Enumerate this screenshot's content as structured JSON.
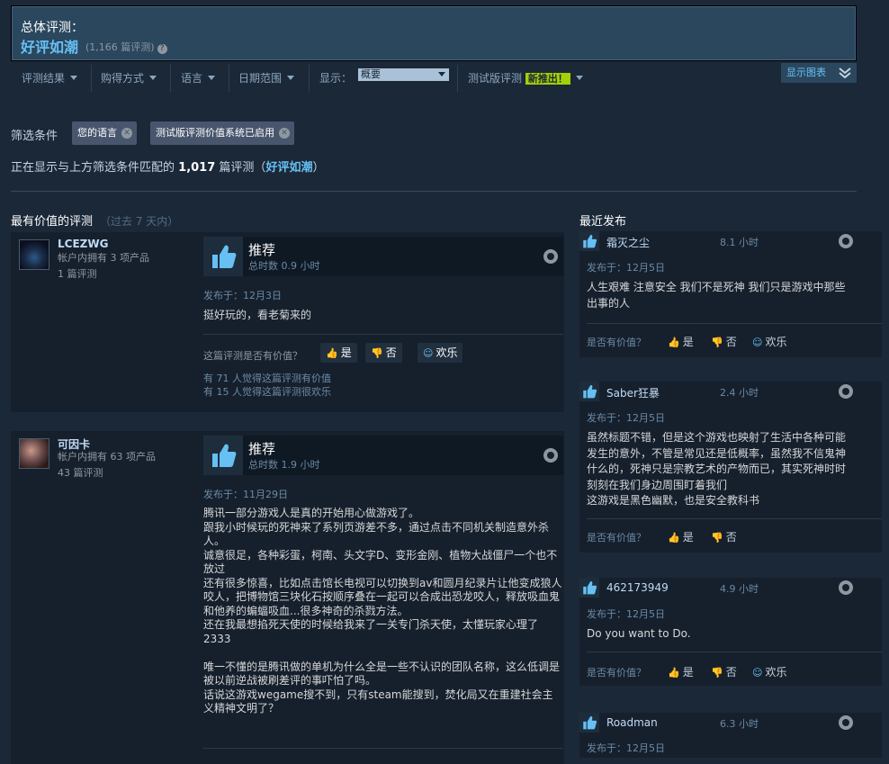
{
  "summary": {
    "label": "总体评测：",
    "rating": "好评如潮",
    "count": "(1,166 篇评测)",
    "help": "?"
  },
  "filterbar": {
    "items": [
      "评测结果",
      "购得方式",
      "语言",
      "日期范围"
    ],
    "display_label": "显示：",
    "display_value": "概要",
    "beta_label": "测试版评测",
    "beta_badge": "新推出！",
    "chart_toggle": "显示图表"
  },
  "filters": {
    "label": "筛选条件",
    "chips": [
      "您的语言",
      "测试版评测价值系统已启用"
    ]
  },
  "matching": {
    "prefix": "正在显示与上方筛选条件匹配的",
    "count": "1,017",
    "suffix": "篇评测（",
    "rating": "好评如潮",
    "close": "）"
  },
  "helpful": {
    "title": "最有价值的评测",
    "period": "（过去 7 天内）"
  },
  "recent_title": "最近发布",
  "reviews": [
    {
      "user": "LCEZWG",
      "products": "帐户内拥有 3 项产品",
      "reviews": "1 篇评测",
      "verdict": "推荐",
      "hours": "总时数 0.9 小时",
      "date": "发布于：12月3日",
      "body": "挺好玩的，看老菊来的",
      "helpful_q": "这篇评测是否有价值？",
      "yes": "是",
      "no": "否",
      "funny": "欢乐",
      "stat1": "有 71 人觉得这篇评测有价值",
      "stat2": "有 15 人觉得这篇评测很欢乐"
    },
    {
      "user": "可因卡",
      "products": "帐户内拥有 63 项产品",
      "reviews": "43 篇评测",
      "verdict": "推荐",
      "hours": "总时数 1.9 小时",
      "date": "发布于：11月29日",
      "body": "腾讯一部分游戏人是真的开始用心做游戏了。\n跟我小时候玩的死神来了系列页游差不多，通过点击不同机关制造意外杀人。\n诚意很足，各种彩蛋，柯南、头文字D、变形金刚、植物大战僵尸一个也不放过\n还有很多惊喜，比如点击馆长电视可以切换到av和圆月纪录片让他变成狼人咬人，把博物馆三块化石按顺序叠在一起可以合成出恐龙咬人，释放吸血鬼和他养的蝙蝠吸血...很多神奇的杀戮方法。\n还在我最想掐死天使的时候给我来了一关专门杀天使，太懂玩家心理了2333\n\n唯一不懂的是腾讯做的单机为什么全是一些不认识的团队名称，这么低调是被以前逆战被刷差评的事吓怕了吗。\n话说这游戏wegame搜不到，只有steam能搜到，焚化局又在重建社会主义精神文明了？"
    }
  ],
  "recent": [
    {
      "user": "霜灭之尘",
      "hours": "8.1 小时",
      "date": "发布于：12月5日",
      "body": "人生艰难 注意安全 我们不是死神 我们只是游戏中那些出事的人",
      "q": "是否有价值？",
      "yes": "是",
      "no": "否",
      "funny": "欢乐"
    },
    {
      "user": "Saber狂暴",
      "hours": "2.4 小时",
      "date": "发布于：12月5日",
      "body": "虽然标题不错，但是这个游戏也映射了生活中各种可能发生的意外，不管是常见还是低概率，虽然我不信鬼神什么的，死神只是宗教艺术的产物而已，其实死神时时刻刻在我们身边周围盯着我们\n这游戏是黑色幽默，也是安全教科书",
      "q": "是否有价值？",
      "yes": "是",
      "no": "否"
    },
    {
      "user": "462173949",
      "hours": "4.9 小时",
      "date": "发布于：12月5日",
      "body": "Do you want to Do.",
      "q": "是否有价值？",
      "yes": "是",
      "no": "否",
      "funny": "欢乐"
    },
    {
      "user": "Roadman",
      "hours": "6.3 小时",
      "date": "发布于：12月5日"
    }
  ],
  "colors": {
    "background": "#1b2838",
    "accent": "#66c0f4",
    "badge": "#a4d007"
  },
  "icons": [
    "thumbs-up-icon",
    "thumbs-down-icon",
    "smiley-icon",
    "steam-icon",
    "close-icon",
    "chevron-down-icon",
    "question-icon"
  ]
}
